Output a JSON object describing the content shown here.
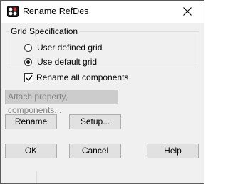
{
  "window": {
    "title": "Rename RefDes",
    "icon": "app-icon",
    "close_icon": "close-icon"
  },
  "grid_spec": {
    "title": "Grid Specification",
    "options": [
      {
        "label": "User defined grid",
        "selected": false
      },
      {
        "label": "Use default grid",
        "selected": true
      }
    ]
  },
  "rename_all": {
    "label": "Rename all components",
    "checked": true
  },
  "attach_button": {
    "label": "Attach property, components...",
    "enabled": false
  },
  "actions": {
    "rename_label": "Rename",
    "setup_label": "Setup..."
  },
  "footer": {
    "ok_label": "OK",
    "cancel_label": "Cancel",
    "help_label": "Help"
  }
}
